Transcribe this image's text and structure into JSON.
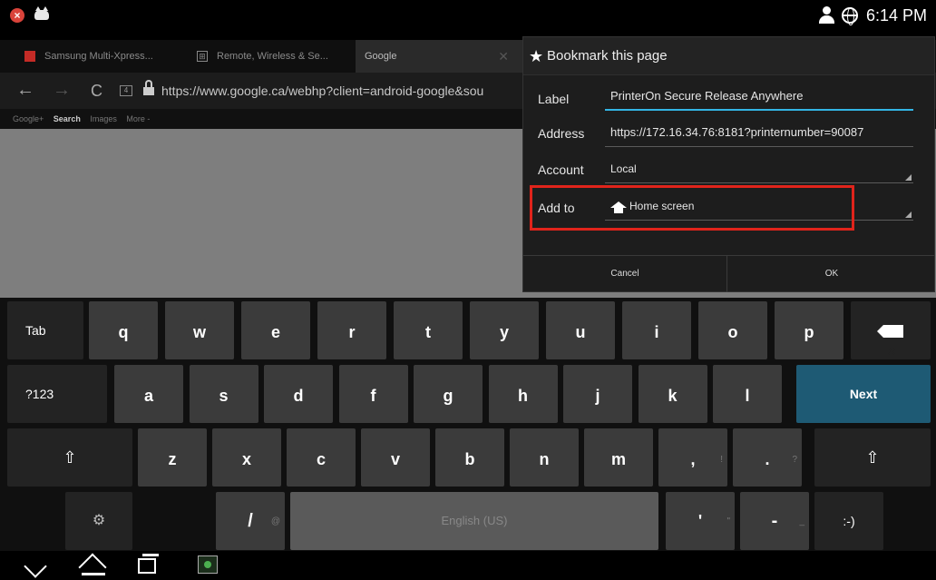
{
  "status_bar": {
    "time": "6:14 PM",
    "left_icons": [
      "notification-x-icon",
      "cat-icon"
    ],
    "right_icons": [
      "person-icon",
      "globe-icon"
    ]
  },
  "browser": {
    "tabs": [
      {
        "label": "Samsung Multi-Xpress..."
      },
      {
        "label": "Remote, Wireless & Se..."
      },
      {
        "label": "Google",
        "active": true
      }
    ],
    "tab_close": "✕",
    "back_label": "←",
    "forward_label": "→",
    "reload_label": "C",
    "tab_count": "4",
    "url": "https://www.google.ca/webhp?client=android-google&sou",
    "google_nav": [
      "Google+",
      "Search",
      "Images",
      "More -"
    ]
  },
  "dialog": {
    "title": "Bookmark this page",
    "fields": {
      "label_label": "Label",
      "label_value": "PrinterOn Secure Release Anywhere",
      "address_label": "Address",
      "address_value": "https://172.16.34.76:8181?printernumber=90087",
      "account_label": "Account",
      "account_value": "Local",
      "addto_label": "Add to",
      "addto_value": "Home screen"
    },
    "cancel_label": "Cancel",
    "ok_label": "OK",
    "highlight_color": "#e0241b"
  },
  "keyboard": {
    "row1": {
      "tab": "Tab",
      "keys": [
        "q",
        "w",
        "e",
        "r",
        "t",
        "y",
        "u",
        "i",
        "o",
        "p"
      ]
    },
    "row2": {
      "sym": "?123",
      "keys": [
        "a",
        "s",
        "d",
        "f",
        "g",
        "h",
        "j",
        "k",
        "l"
      ],
      "next": "Next"
    },
    "row3": {
      "keys": [
        "z",
        "x",
        "c",
        "v",
        "b",
        "n",
        "m",
        ",",
        "."
      ],
      "shift_label": "⇧",
      "sub_comma": "!",
      "sub_period": "?"
    },
    "row4": {
      "settings": "⚙",
      "slash": "/",
      "slash_sub": "@",
      "space": "English (US)",
      "apostrophe": "'",
      "apostrophe_sub": "\"",
      "dash": "-",
      "dash_sub": "_",
      "smiley": ":-)"
    },
    "next_color": "#1e5a74"
  },
  "navbar": {
    "icons": [
      "back-icon",
      "home-icon",
      "recent-apps-icon",
      "screenshot-icon"
    ]
  }
}
